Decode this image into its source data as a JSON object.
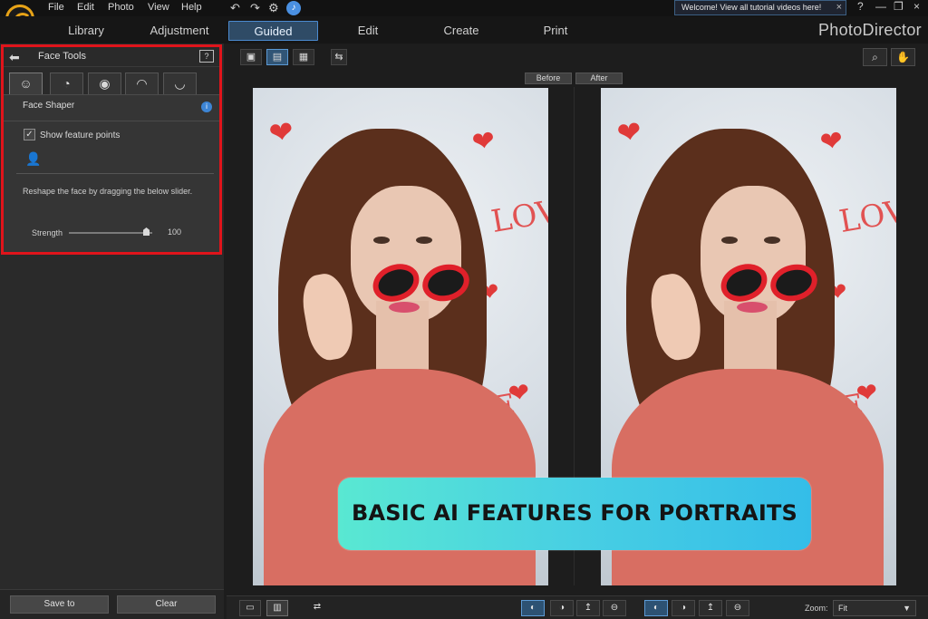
{
  "app": {
    "brand": "PhotoDirector",
    "menu": [
      "File",
      "Edit",
      "Photo",
      "View",
      "Help"
    ],
    "welcome": "Welcome! View all tutorial videos here!",
    "tabs": [
      "Library",
      "Adjustment",
      "Guided",
      "Edit",
      "Create",
      "Print"
    ],
    "active_tab": "Guided"
  },
  "left_panel": {
    "title": "Face Tools",
    "section": "Face Shaper",
    "checkbox_label": "Show feature points",
    "instruction": "Reshape the face by dragging the below slider.",
    "strength_label": "Strength",
    "strength_value": "100",
    "save_button": "Save to",
    "clear_button": "Clear"
  },
  "compare": {
    "before": "Before",
    "after": "After"
  },
  "banner": {
    "text": "BASIC AI FEATURES FOR PORTRAITS"
  },
  "bottom": {
    "zoom_label": "Zoom:",
    "zoom_value": "Fit"
  },
  "colors": {
    "highlight": "#e0141b",
    "accent": "#4b8ad0",
    "banner_start": "#59e8d2",
    "banner_end": "#34bde8"
  },
  "icons": {
    "back": "back-arrow-icon",
    "help": "help-icon",
    "info": "info-icon",
    "add_user": "add-user-icon",
    "search": "search-icon",
    "hand": "hand-icon"
  }
}
